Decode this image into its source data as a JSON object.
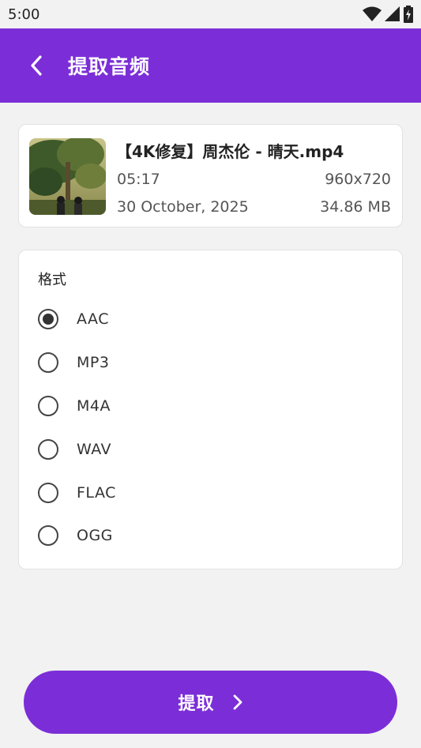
{
  "status_bar": {
    "time": "5:00",
    "icons": [
      "wifi-icon",
      "signal-icon",
      "battery-icon"
    ]
  },
  "app_bar": {
    "title": "提取音频",
    "back_icon": "chevron-left-icon"
  },
  "file": {
    "name": "【4K修复】周杰伦 - 晴天.mp4",
    "duration": "05:17",
    "resolution": "960x720",
    "date": "30 October, 2025",
    "size": "34.86 MB"
  },
  "format": {
    "label": "格式",
    "selected": "AAC",
    "options": [
      {
        "label": "AAC",
        "selected": true
      },
      {
        "label": "MP3",
        "selected": false
      },
      {
        "label": "M4A",
        "selected": false
      },
      {
        "label": "WAV",
        "selected": false
      },
      {
        "label": "FLAC",
        "selected": false
      },
      {
        "label": "OGG",
        "selected": false
      }
    ]
  },
  "action": {
    "label": "提取",
    "icon": "chevron-right-icon"
  },
  "colors": {
    "accent": "#7b2ed7",
    "background": "#f2f2f2",
    "card": "#ffffff"
  }
}
